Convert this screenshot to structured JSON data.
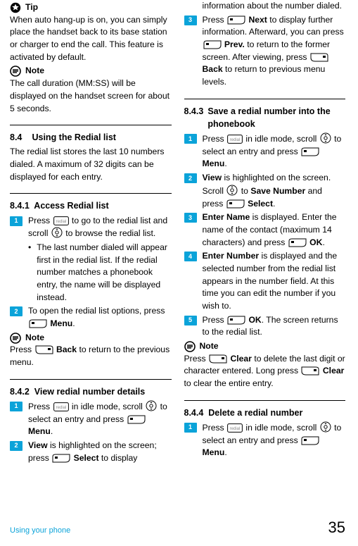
{
  "col1": {
    "tip_label": "Tip",
    "tip_body": "When auto hang-up is on, you can simply place the handset back to its base station or charger to end the call. This feature is activated by default.",
    "note1_label": "Note",
    "note1_body": "The call duration (MM:SS) will be displayed on the handset screen for about 5 seconds.",
    "s84_num": "8.4",
    "s84_title": "Using the Redial list",
    "s84_body": "The redial list stores the last 10 numbers dialed. A maximum of 32 digits can be displayed for each entry.",
    "s841_num": "8.4.1",
    "s841_title": "Access Redial list",
    "s841_step1a": "Press ",
    "s841_step1b": " to go to the redial list and scroll ",
    "s841_step1c": " to browse the redial list.",
    "s841_bullet": "The last number dialed will appear first in the redial list. If the redial number matches a phonebook entry, the name will be displayed instead.",
    "s841_step2a": "To open the redial list options, press ",
    "s841_step2b": "Menu",
    "s841_step2c": ".",
    "note2_label": "Note",
    "note2_body_a": "Press ",
    "note2_body_b": "Back",
    "note2_body_c": " to return to the previous menu.",
    "s842_num": "8.4.2",
    "s842_title": "View redial number details",
    "s842_step1a": "Press ",
    "s842_step1b": " in idle mode, scroll ",
    "s842_step1c": " to select an entry and press ",
    "s842_step1d": "Menu",
    "s842_step1e": ".",
    "s842_step2a": "View",
    "s842_step2b": " is highlighted on the screen; press ",
    "s842_step2c": "Select",
    "s842_step2d": " to display "
  },
  "col2": {
    "cont_top": "information about the number dialed.",
    "s842_step3a": "Press ",
    "s842_step3b": "Next",
    "s842_step3c": " to display further information. Afterward, you can press ",
    "s842_step3d": "Prev.",
    "s842_step3e": " to return to the former screen. After viewing, press ",
    "s842_step3f": "Back",
    "s842_step3g": " to return to previous menu levels.",
    "s843_num": "8.4.3",
    "s843_title": "Save a redial number into the phonebook",
    "s843_step1a": "Press ",
    "s843_step1b": " in idle mode, scroll ",
    "s843_step1c": " to select an entry and press ",
    "s843_step1d": "Menu",
    "s843_step1e": ".",
    "s843_step2a": "View",
    "s843_step2b": " is highlighted on the screen. Scroll ",
    "s843_step2c": " to ",
    "s843_step2d": "Save Number",
    "s843_step2e": " and press ",
    "s843_step2f": "Select",
    "s843_step2g": ".",
    "s843_step3a": "Enter Name",
    "s843_step3b": " is displayed. Enter the name of the contact (maximum 14 characters) and press ",
    "s843_step3c": "OK",
    "s843_step3d": ".",
    "s843_step4a": "Enter Number",
    "s843_step4b": " is displayed and the selected number from the redial list appears in the number field. At this time you can edit the number if you wish to.",
    "s843_step5a": "Press ",
    "s843_step5b": "OK",
    "s843_step5c": ". The screen returns to the redial list.",
    "note3_label": "Note",
    "note3_a": "Press ",
    "note3_b": "Clear",
    "note3_c": " to delete the last digit or character entered. Long press ",
    "note3_d": "Clear",
    "note3_e": " to clear the entire entry.",
    "s844_num": "8.4.4",
    "s844_title": "Delete a redial number",
    "s844_step1a": "Press ",
    "s844_step1b": " in idle mode, scroll ",
    "s844_step1c": " to select an entry and press ",
    "s844_step1d": "Menu",
    "s844_step1e": "."
  },
  "footer": {
    "left": "Using your phone",
    "right": "35"
  },
  "steps": {
    "n1": "1",
    "n2": "2",
    "n3": "3",
    "n4": "4",
    "n5": "5"
  }
}
